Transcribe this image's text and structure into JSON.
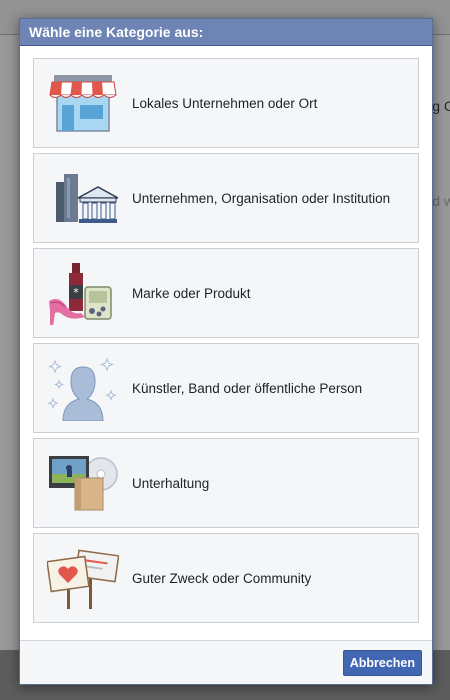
{
  "background": {
    "partial_text_1": "g C",
    "partial_text_2": "d w"
  },
  "dialog": {
    "title": "Wähle eine Kategorie aus:",
    "categories": [
      {
        "label": "Lokales Unternehmen oder Ort",
        "icon": "storefront-icon"
      },
      {
        "label": "Unternehmen, Organisation oder Institution",
        "icon": "company-buildings-icon"
      },
      {
        "label": "Marke oder Produkt",
        "icon": "brand-products-icon"
      },
      {
        "label": "Künstler, Band oder öffentliche Person",
        "icon": "public-person-icon"
      },
      {
        "label": "Unterhaltung",
        "icon": "entertainment-icon"
      },
      {
        "label": "Guter Zweck oder Community",
        "icon": "cause-signs-icon"
      }
    ],
    "cancel_label": "Abbrechen"
  },
  "colors": {
    "header_bg": "#6d84b4",
    "button_bg": "#4267b2",
    "card_bg": "#f5f6f7",
    "card_border": "#ccd0d5"
  }
}
